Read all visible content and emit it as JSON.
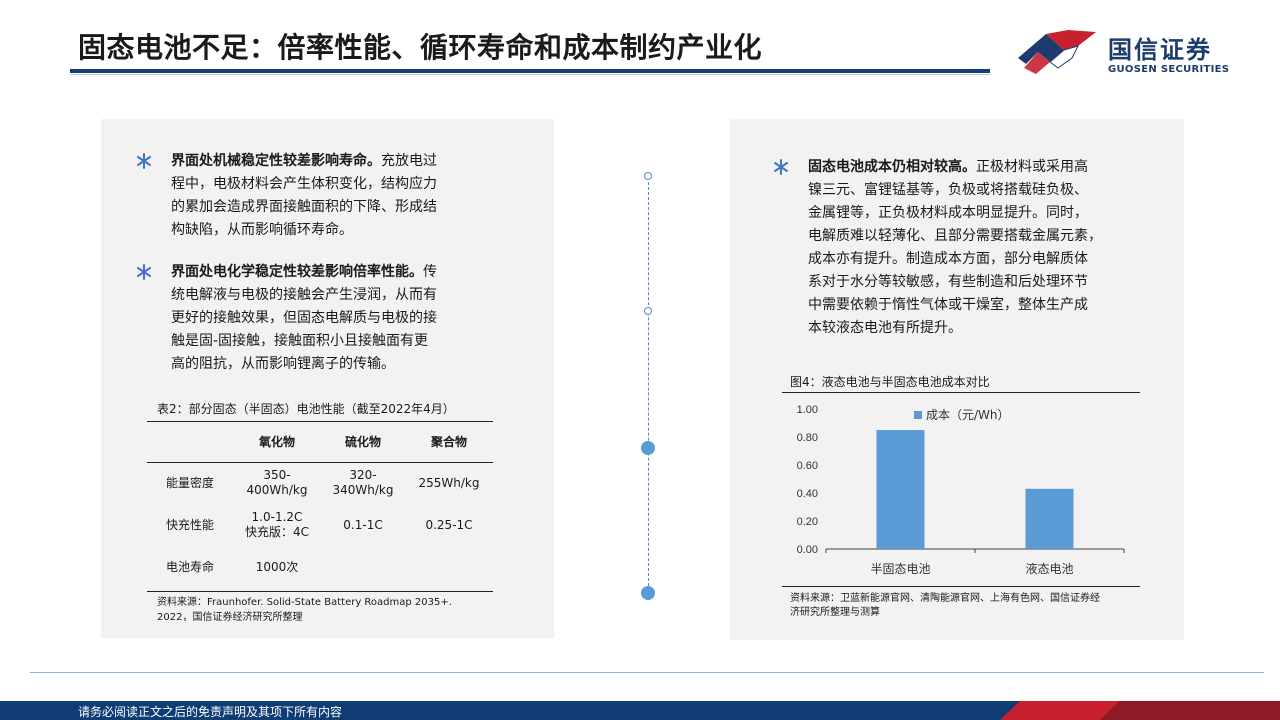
{
  "header": {
    "title": "固态电池不足：倍率性能、循环寿命和成本制约产业化",
    "logo_cn": "国信证券",
    "logo_en": "GUOSEN SECURITIES",
    "logo_label": "国信证券 GUOSEN SECURITIES"
  },
  "colors": {
    "navy": "#0f3f78",
    "accent_blue": "#5b9bd5",
    "accent_red": "#c8202f",
    "panel_bg": "#f2f2f2"
  },
  "left": {
    "bullets": [
      {
        "icon": "asterisk-icon",
        "bold": "界面处机械稳定性较差影响寿命。",
        "lines": [
          "充放电过",
          "程中，电极材料会产生体积变化，结构应力",
          "的累加会造成界面接触面积的下降、形成结",
          "构缺陷，从而影响循环寿命。"
        ]
      },
      {
        "icon": "asterisk-icon",
        "bold": "界面处电化学稳定性较差影响倍率性能。",
        "lines": [
          "传",
          "统电解液与电极的接触会产生浸润，从而有",
          "更好的接触效果，但固态电解质与电极的接",
          "触是固-固接触，接触面积小且接触面有更",
          "高的阻抗，从而影响锂离子的传输。"
        ]
      }
    ],
    "table": {
      "caption": "表2：部分固态（半固态）电池性能（截至2022年4月）",
      "columns": [
        "",
        "氧化物",
        "硫化物",
        "聚合物"
      ],
      "rows": [
        {
          "label": "能量密度",
          "cells": [
            [
              "350-",
              "400Wh/kg"
            ],
            [
              "320-",
              "340Wh/kg"
            ],
            [
              "255Wh/kg"
            ]
          ]
        },
        {
          "label": "快充性能",
          "cells": [
            [
              "1.0-1.2C",
              "快充版：4C"
            ],
            [
              "0.1-1C"
            ],
            [
              "0.25-1C"
            ]
          ]
        },
        {
          "label": "电池寿命",
          "cells": [
            [
              "1000次"
            ],
            [
              ""
            ],
            [
              ""
            ]
          ]
        }
      ],
      "source_lines": [
        "资料来源：Fraunhofer. Solid-State Battery Roadmap 2035+.",
        "2022，国信证券经济研究所整理"
      ]
    }
  },
  "right": {
    "bullet": {
      "icon": "asterisk-icon",
      "bold": "固态电池成本仍相对较高。",
      "lines": [
        "正极材料或采用高",
        "镍三元、富锂锰基等，负极或将搭载硅负极、",
        "金属锂等，正负极材料成本明显提升。同时，",
        "电解质难以轻薄化、且部分需要搭载金属元素，",
        "成本亦有提升。制造成本方面，部分电解质体",
        "系对于水分等较敏感，有些制造和后处理环节",
        "中需要依赖于惰性气体或干燥室，整体生产成",
        "本较液态电池有所提升。"
      ]
    },
    "chart_caption": "图4：液态电池与半固态电池成本对比",
    "chart_source_lines": [
      "资料来源：卫蓝新能源官网、清陶能源官网、上海有色网、国信证券经",
      "济研究所整理与测算"
    ]
  },
  "chart_data": {
    "type": "bar",
    "title": "",
    "categories": [
      "半固态电池",
      "液态电池"
    ],
    "series": [
      {
        "name": "成本（元/Wh）",
        "values": [
          0.85,
          0.43
        ]
      }
    ],
    "y_ticks": [
      "0.00",
      "0.20",
      "0.40",
      "0.60",
      "0.80",
      "1.00"
    ],
    "ylim": [
      0,
      1
    ],
    "legend": "top-center",
    "grid": false,
    "bar_color": "#5b9bd5"
  },
  "footer": {
    "disclaimer": "请务必阅读正文之后的免责声明及其项下所有内容"
  }
}
